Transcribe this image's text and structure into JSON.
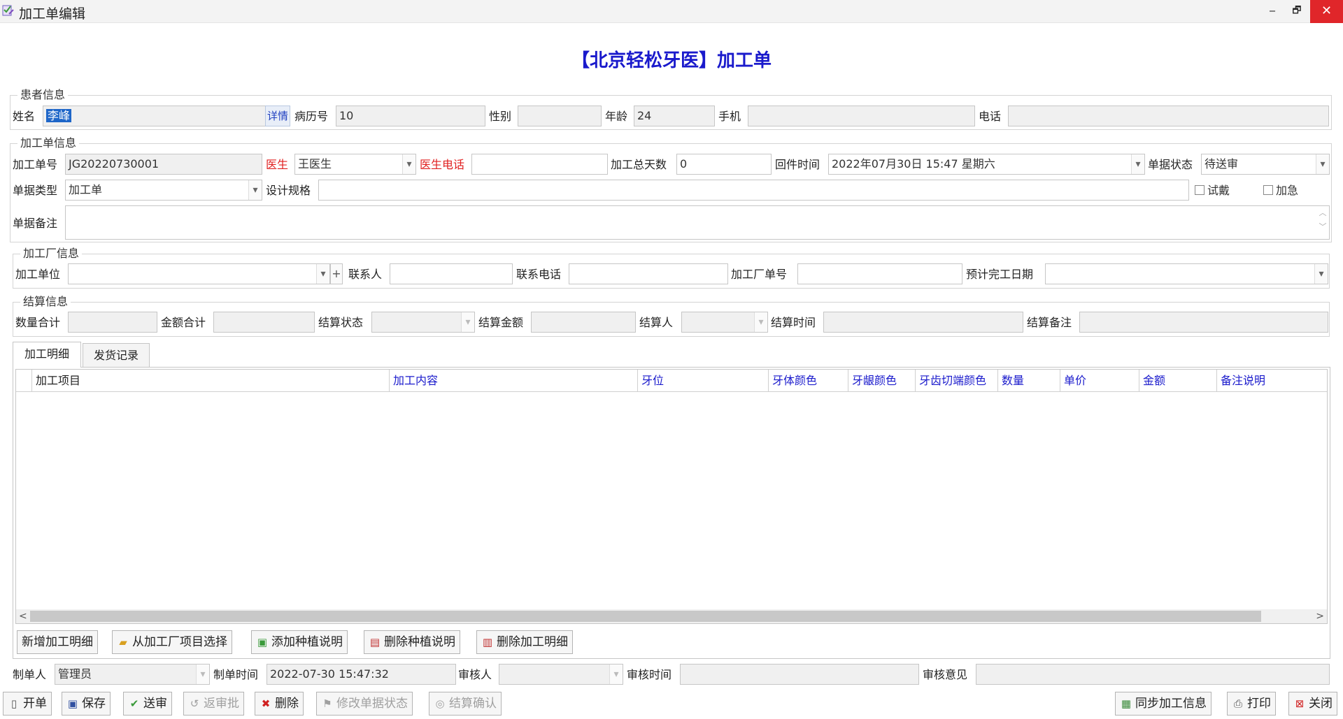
{
  "window": {
    "title": "加工单编辑",
    "min": "‒",
    "max": "🗗",
    "close": "✕"
  },
  "page_title": "【北京轻松牙医】加工单",
  "patient": {
    "group": "患者信息",
    "name_label": "姓名",
    "name_value": "李峰",
    "detail": "详情",
    "record_label": "病历号",
    "record_value": "10",
    "gender_label": "性别",
    "gender_value": "",
    "age_label": "年龄",
    "age_value": "24",
    "mobile_label": "手机",
    "mobile_value": "",
    "phone_label": "电话",
    "phone_value": ""
  },
  "order": {
    "group": "加工单信息",
    "no_label": "加工单号",
    "no_value": "JG20220730001",
    "doctor_label": "医生",
    "doctor_value": "王医生",
    "doctor_phone_label": "医生电话",
    "doctor_phone_value": "",
    "days_label": "加工总天数",
    "days_value": "0",
    "return_label": "回件时间",
    "return_value": "2022年07月30日 15:47 星期六",
    "status_label": "单据状态",
    "status_value": "待送审",
    "type_label": "单据类型",
    "type_value": "加工单",
    "spec_label": "设计规格",
    "spec_value": "",
    "try_label": "试戴",
    "urgent_label": "加急",
    "remark_label": "单据备注"
  },
  "factory": {
    "group": "加工厂信息",
    "unit_label": "加工单位",
    "unit_value": "",
    "plus": "+",
    "contact_label": "联系人",
    "contact_value": "",
    "contact_phone_label": "联系电话",
    "contact_phone_value": "",
    "factory_no_label": "加工厂单号",
    "factory_no_value": "",
    "finish_label": "预计完工日期",
    "finish_value": ""
  },
  "settle": {
    "group": "结算信息",
    "qty_label": "数量合计",
    "amount_label": "金额合计",
    "status_label": "结算状态",
    "money_label": "结算金额",
    "person_label": "结算人",
    "time_label": "结算时间",
    "remark_label": "结算备注"
  },
  "tabs": [
    "加工明细",
    "发货记录"
  ],
  "grid": {
    "columns": [
      "加工项目",
      "加工内容",
      "牙位",
      "牙体颜色",
      "牙龈颜色",
      "牙齿切端颜色",
      "数量",
      "单价",
      "金额",
      "备注说明"
    ]
  },
  "detail_buttons": [
    "新增加工明细",
    "从加工厂项目选择",
    "添加种植说明",
    "删除种植说明",
    "删除加工明细"
  ],
  "audit": {
    "maker_label": "制单人",
    "maker_value": "管理员",
    "make_time_label": "制单时间",
    "make_time_value": "2022-07-30 15:47:32",
    "auditor_label": "审核人",
    "auditor_value": "",
    "audit_time_label": "审核时间",
    "audit_time_value": "",
    "opinion_label": "审核意见",
    "opinion_value": ""
  },
  "toolbar": {
    "new": "开单",
    "save": "保存",
    "submit": "送审",
    "reject": "返审批",
    "delete": "删除",
    "modify_status": "修改单据状态",
    "settle_confirm": "结算确认",
    "sync": "同步加工信息",
    "print": "打印",
    "close": "关闭"
  }
}
